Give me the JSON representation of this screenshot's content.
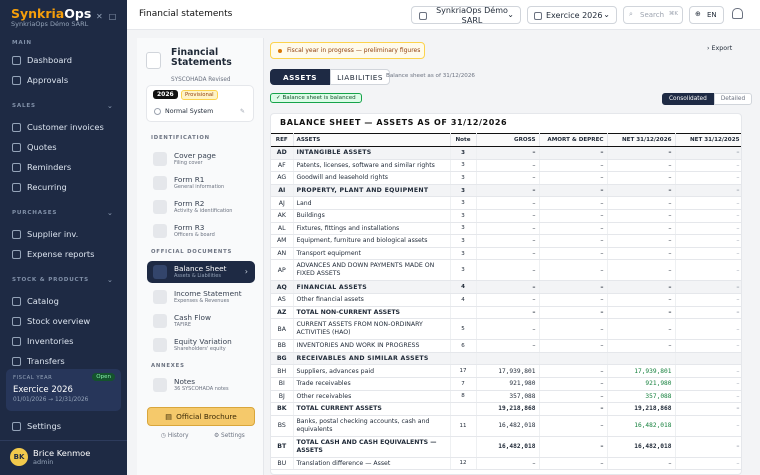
{
  "app": {
    "brand_main": "Synkria",
    "brand_sub": "Ops",
    "org": "SynkriaOps Démo SARL"
  },
  "sidebar": {
    "sections": {
      "main": "MAIN",
      "sales": "SALES",
      "purchases": "PURCHASES",
      "stock": "STOCK & PRODUCTS"
    },
    "items": {
      "dashboard": "Dashboard",
      "approvals": "Approvals",
      "invoices": "Customer invoices",
      "quotes": "Quotes",
      "reminders": "Reminders",
      "recurring": "Recurring",
      "supplier": "Supplier inv.",
      "expense": "Expense reports",
      "catalog": "Catalog",
      "stock": "Stock overview",
      "inventories": "Inventories",
      "transfers": "Transfers",
      "settings": "Settings"
    },
    "fiscal": {
      "label": "FISCAL YEAR",
      "badge": "Open",
      "year": "Exercice 2026",
      "range": "01/01/2026 → 12/31/2026"
    },
    "user": {
      "initials": "BK",
      "name": "Brice Kenmoe",
      "role": "admin"
    }
  },
  "topbar": {
    "title": "Financial statements",
    "company": "SynkriaOps Démo SARL",
    "exercise": "Exercice 2026",
    "search": "Search",
    "kbd": "⌘K",
    "lang": "EN"
  },
  "left": {
    "title": "Financial Statements",
    "sub": "SYSCOHADA Revised",
    "year": "2026",
    "status": "Provisional",
    "system": "Normal System",
    "sec_id": "IDENTIFICATION",
    "sec_docs": "OFFICIAL DOCUMENTS",
    "sec_ann": "ANNEXES",
    "forms": [
      {
        "a": "Cover page",
        "b": "Filing cover"
      },
      {
        "a": "Form R1",
        "b": "General information"
      },
      {
        "a": "Form R2",
        "b": "Activity & identification"
      },
      {
        "a": "Form R3",
        "b": "Officers & board"
      }
    ],
    "docs": [
      {
        "a": "Balance Sheet",
        "b": "Assets & Liabilities"
      },
      {
        "a": "Income Statement",
        "b": "Expenses & Revenues"
      },
      {
        "a": "Cash Flow",
        "b": "TAFIRE"
      },
      {
        "a": "Equity Variation",
        "b": "Shareholders' equity"
      }
    ],
    "notes": {
      "a": "Notes",
      "b": "36 SYSCOHADA notes"
    },
    "brochure": "Official Brochure",
    "history": "History",
    "settings": "Settings"
  },
  "main": {
    "warning": "Fiscal year in progress — preliminary figures",
    "export": "Export",
    "tab_assets": "ASSETS",
    "tab_liab": "LIABILITIES",
    "date_note": "Balance sheet as of 31/12/2026",
    "balanced": "✓ Balance sheet is balanced",
    "consolidated": "Consolidated",
    "detailed": "Detailed",
    "card_title": "BALANCE SHEET — ASSETS AS OF 31/12/2026",
    "cols": [
      "REF",
      "ASSETS",
      "Note",
      "GROSS",
      "AMORT & DEPREC",
      "NET 31/12/2026",
      "NET 31/12/2025"
    ]
  }
}
